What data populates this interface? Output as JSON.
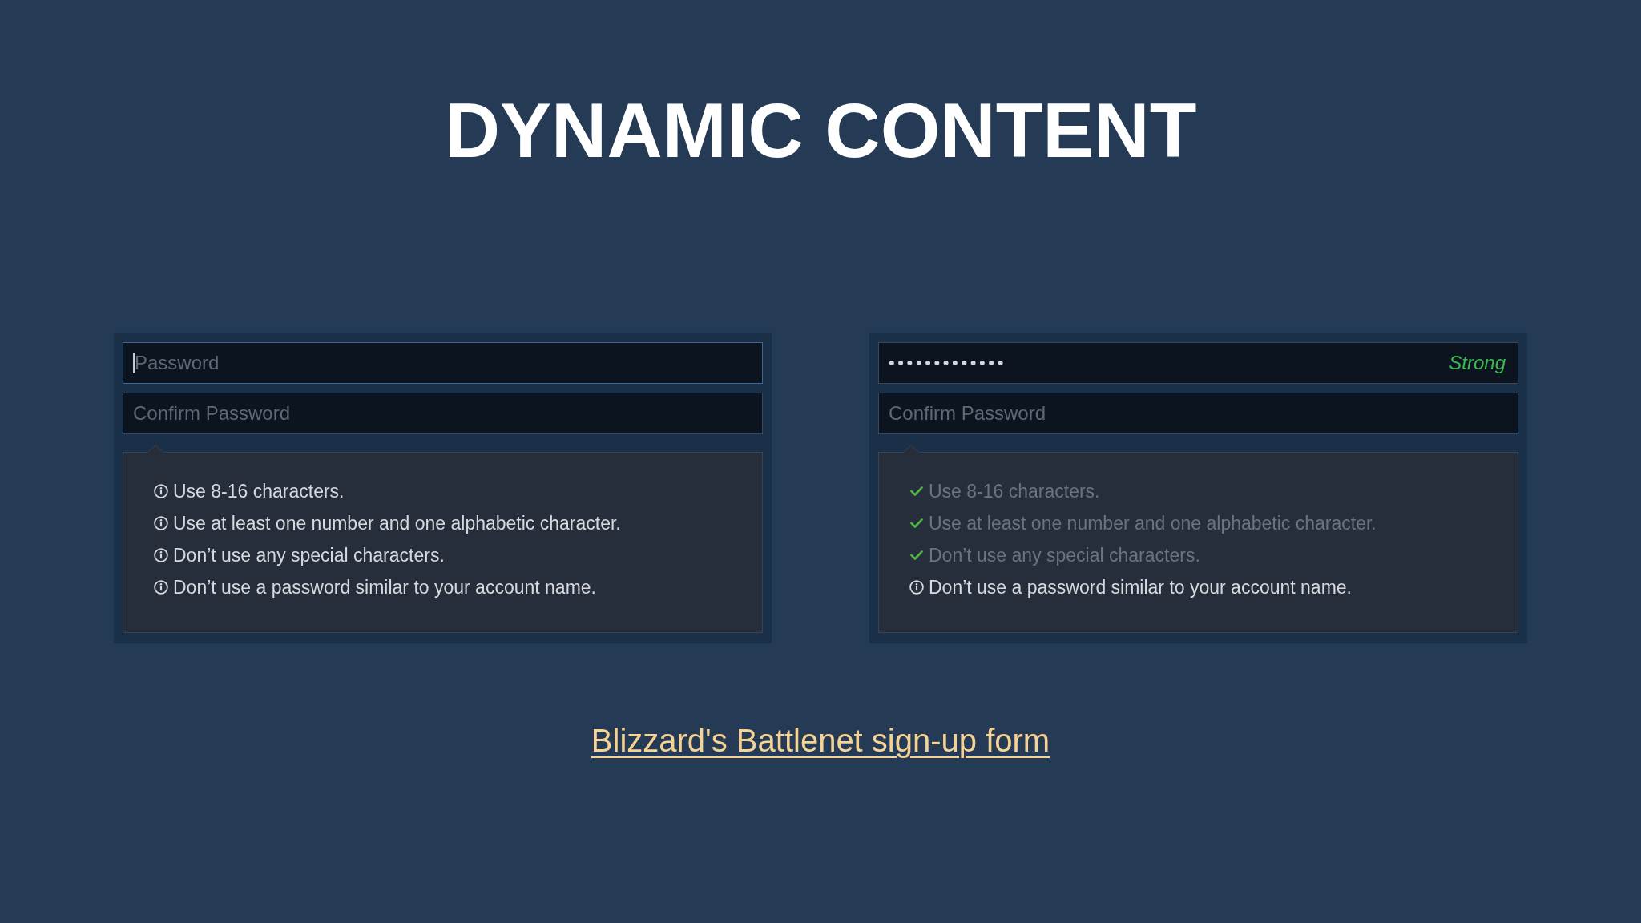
{
  "title": "DYNAMIC CONTENT",
  "examples": [
    {
      "password_field": {
        "placeholder": "Password",
        "focused": true
      },
      "confirm_field": {
        "placeholder": "Confirm Password"
      },
      "requirements": [
        {
          "text": "Use 8-16 characters.",
          "met": false
        },
        {
          "text": "Use at least one number and one alphabetic character.",
          "met": false
        },
        {
          "text": "Don’t use any special characters.",
          "met": false
        },
        {
          "text": "Don’t use a password similar to your account name.",
          "met": false
        }
      ]
    },
    {
      "password_field": {
        "value": "•••••••••••••",
        "strength": "Strong",
        "focused": false
      },
      "confirm_field": {
        "placeholder": "Confirm Password"
      },
      "requirements": [
        {
          "text": "Use 8-16 characters.",
          "met": true
        },
        {
          "text": "Use at least one number and one alphabetic character.",
          "met": true
        },
        {
          "text": "Don’t use any special characters.",
          "met": true
        },
        {
          "text": "Don’t use a password similar to your account name.",
          "met": false
        }
      ]
    }
  ],
  "link": "Blizzard's Battlenet sign-up form"
}
